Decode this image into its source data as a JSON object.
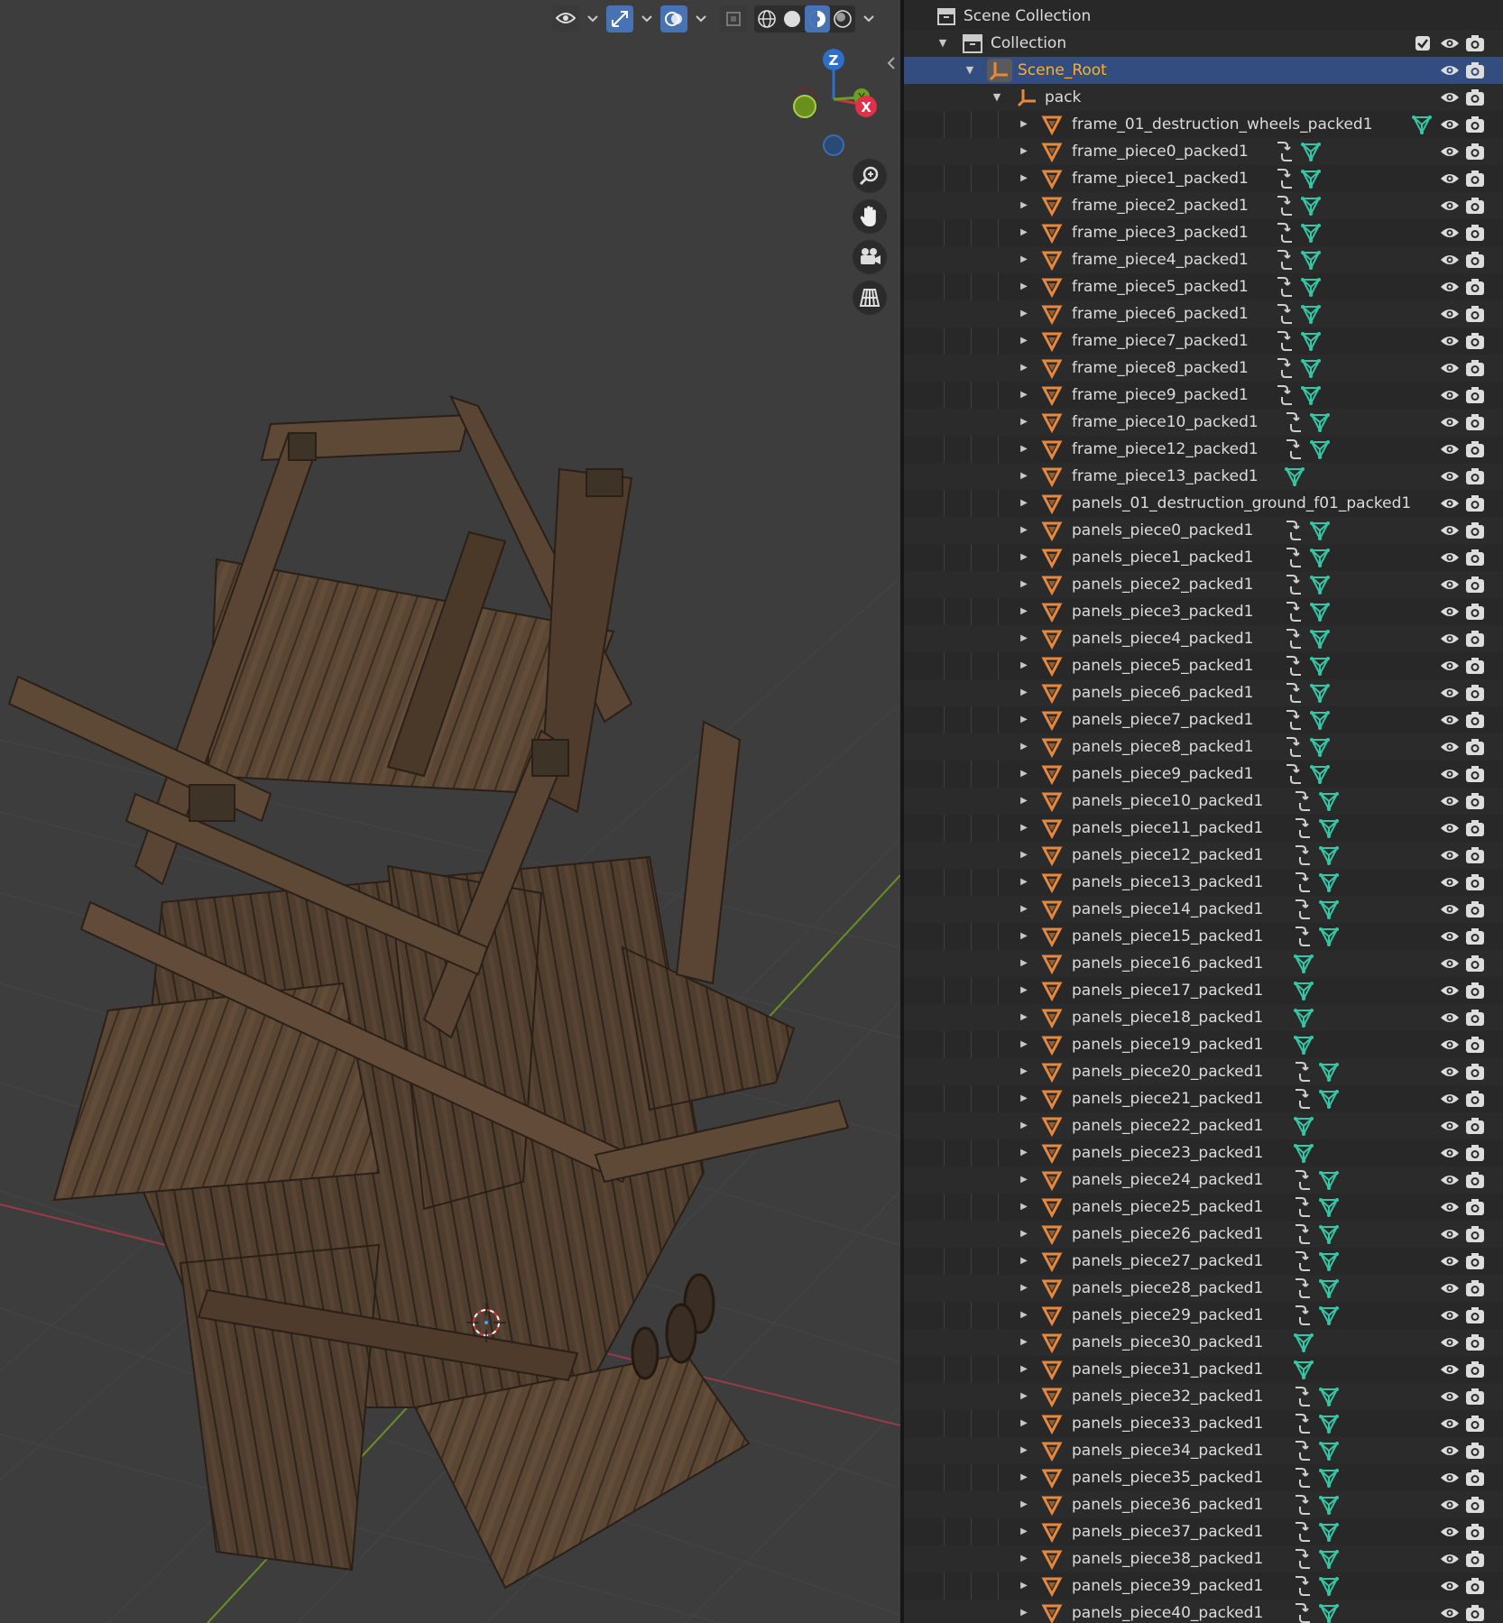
{
  "viewport": {
    "header": {
      "visibility_icon": "eye-filter-icon",
      "gizmo_toggle_icon": "gizmo-icon",
      "overlay_toggle_icon": "overlays-icon",
      "xray_icon": "xray-icon",
      "shading_modes": [
        "wireframe",
        "solid",
        "material-preview",
        "rendered"
      ],
      "active_shading": "material-preview"
    },
    "axis_gizmo": {
      "labels": [
        "Z",
        "Y",
        "X"
      ]
    },
    "nav_tools": [
      "zoom-icon",
      "pan-hand-icon",
      "camera-icon",
      "ortho-grid-icon"
    ],
    "colors": {
      "bg": "#3d3d3d",
      "grid": "#464646",
      "x_axis": "#9a3a47",
      "y_axis": "#6b8f24",
      "wood": "#5a4534"
    }
  },
  "outliner": {
    "colors": {
      "selected_row": "#334d80",
      "selected_text": "#ffaf29",
      "mesh_icon": "#e8883c",
      "data_icon": "#35c7a5"
    },
    "scene_collection": {
      "label": "Scene Collection"
    },
    "collection": {
      "label": "Collection"
    },
    "scene_root": {
      "label": "Scene_Root"
    },
    "pack": {
      "label": "pack"
    },
    "items": [
      {
        "label": "frame_01_destruction_wheels_packed1",
        "modifier": false
      },
      {
        "label": "frame_piece0_packed1",
        "modifier": true
      },
      {
        "label": "frame_piece1_packed1",
        "modifier": true
      },
      {
        "label": "frame_piece2_packed1",
        "modifier": true
      },
      {
        "label": "frame_piece3_packed1",
        "modifier": true
      },
      {
        "label": "frame_piece4_packed1",
        "modifier": true
      },
      {
        "label": "frame_piece5_packed1",
        "modifier": true
      },
      {
        "label": "frame_piece6_packed1",
        "modifier": true
      },
      {
        "label": "frame_piece7_packed1",
        "modifier": true
      },
      {
        "label": "frame_piece8_packed1",
        "modifier": true
      },
      {
        "label": "frame_piece9_packed1",
        "modifier": true
      },
      {
        "label": "frame_piece10_packed1",
        "modifier": true
      },
      {
        "label": "frame_piece12_packed1",
        "modifier": true
      },
      {
        "label": "frame_piece13_packed1",
        "modifier": false
      },
      {
        "label": "panels_01_destruction_ground_f01_packed1",
        "modifier": false,
        "no_data": true
      },
      {
        "label": "panels_piece0_packed1",
        "modifier": true
      },
      {
        "label": "panels_piece1_packed1",
        "modifier": true
      },
      {
        "label": "panels_piece2_packed1",
        "modifier": true
      },
      {
        "label": "panels_piece3_packed1",
        "modifier": true
      },
      {
        "label": "panels_piece4_packed1",
        "modifier": true
      },
      {
        "label": "panels_piece5_packed1",
        "modifier": true
      },
      {
        "label": "panels_piece6_packed1",
        "modifier": true
      },
      {
        "label": "panels_piece7_packed1",
        "modifier": true
      },
      {
        "label": "panels_piece8_packed1",
        "modifier": true
      },
      {
        "label": "panels_piece9_packed1",
        "modifier": true
      },
      {
        "label": "panels_piece10_packed1",
        "modifier": true
      },
      {
        "label": "panels_piece11_packed1",
        "modifier": true
      },
      {
        "label": "panels_piece12_packed1",
        "modifier": true
      },
      {
        "label": "panels_piece13_packed1",
        "modifier": true
      },
      {
        "label": "panels_piece14_packed1",
        "modifier": true
      },
      {
        "label": "panels_piece15_packed1",
        "modifier": true
      },
      {
        "label": "panels_piece16_packed1",
        "modifier": false
      },
      {
        "label": "panels_piece17_packed1",
        "modifier": false
      },
      {
        "label": "panels_piece18_packed1",
        "modifier": false
      },
      {
        "label": "panels_piece19_packed1",
        "modifier": false
      },
      {
        "label": "panels_piece20_packed1",
        "modifier": true
      },
      {
        "label": "panels_piece21_packed1",
        "modifier": true
      },
      {
        "label": "panels_piece22_packed1",
        "modifier": false
      },
      {
        "label": "panels_piece23_packed1",
        "modifier": false
      },
      {
        "label": "panels_piece24_packed1",
        "modifier": true
      },
      {
        "label": "panels_piece25_packed1",
        "modifier": true
      },
      {
        "label": "panels_piece26_packed1",
        "modifier": true
      },
      {
        "label": "panels_piece27_packed1",
        "modifier": true
      },
      {
        "label": "panels_piece28_packed1",
        "modifier": true
      },
      {
        "label": "panels_piece29_packed1",
        "modifier": true
      },
      {
        "label": "panels_piece30_packed1",
        "modifier": false
      },
      {
        "label": "panels_piece31_packed1",
        "modifier": false
      },
      {
        "label": "panels_piece32_packed1",
        "modifier": true
      },
      {
        "label": "panels_piece33_packed1",
        "modifier": true
      },
      {
        "label": "panels_piece34_packed1",
        "modifier": true
      },
      {
        "label": "panels_piece35_packed1",
        "modifier": true
      },
      {
        "label": "panels_piece36_packed1",
        "modifier": true
      },
      {
        "label": "panels_piece37_packed1",
        "modifier": true
      },
      {
        "label": "panels_piece38_packed1",
        "modifier": true
      },
      {
        "label": "panels_piece39_packed1",
        "modifier": true
      },
      {
        "label": "panels_piece40_packed1",
        "modifier": true
      }
    ]
  }
}
